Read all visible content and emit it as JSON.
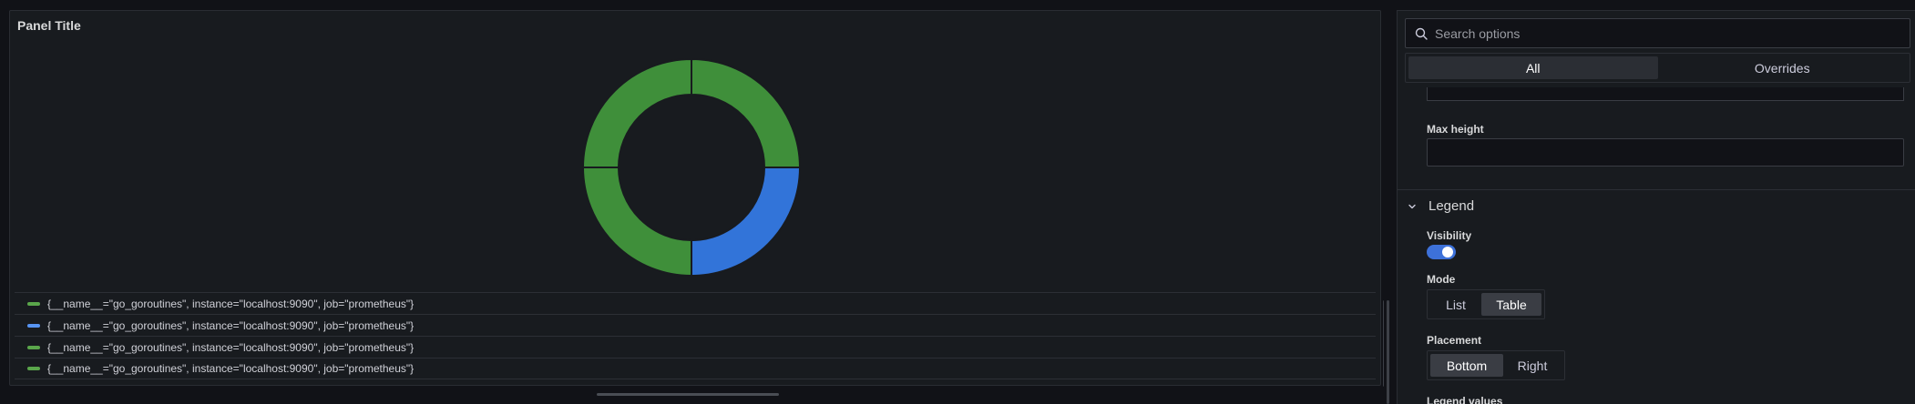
{
  "panel": {
    "title": "Panel Title",
    "legend": [
      {
        "label": "{__name__=\"go_goroutines\", instance=\"localhost:9090\", job=\"prometheus\"}",
        "color": "#5aa64b"
      },
      {
        "label": "{__name__=\"go_goroutines\", instance=\"localhost:9090\", job=\"prometheus\"}",
        "color": "#5794f2"
      },
      {
        "label": "{__name__=\"go_goroutines\", instance=\"localhost:9090\", job=\"prometheus\"}",
        "color": "#5aa64b"
      },
      {
        "label": "{__name__=\"go_goroutines\", instance=\"localhost:9090\", job=\"prometheus\"}",
        "color": "#5aa64b"
      }
    ]
  },
  "chart_data": {
    "type": "pie",
    "donut": true,
    "title": "Panel Title",
    "slices": [
      {
        "name": "{__name__=\"go_goroutines\", instance=\"localhost:9090\", job=\"prometheus\"}",
        "value": 25,
        "color": "#3f8f3a"
      },
      {
        "name": "{__name__=\"go_goroutines\", instance=\"localhost:9090\", job=\"prometheus\"}",
        "value": 25,
        "color": "#3274d9"
      },
      {
        "name": "{__name__=\"go_goroutines\", instance=\"localhost:9090\", job=\"prometheus\"}",
        "value": 25,
        "color": "#3f8f3a"
      },
      {
        "name": "{__name__=\"go_goroutines\", instance=\"localhost:9090\", job=\"prometheus\"}",
        "value": 25,
        "color": "#3f8f3a"
      }
    ],
    "legend_placement": "bottom"
  },
  "options": {
    "search_placeholder": "Search options",
    "tabs": [
      {
        "label": "All",
        "active": true
      },
      {
        "label": "Overrides",
        "active": false
      }
    ],
    "max_height_label": "Max height",
    "max_height_value": "",
    "legend_section": {
      "title": "Legend",
      "visibility_label": "Visibility",
      "visibility_on": true,
      "mode_label": "Mode",
      "mode_options": [
        "List",
        "Table"
      ],
      "mode_selected": "Table",
      "placement_label": "Placement",
      "placement_options": [
        "Bottom",
        "Right"
      ],
      "placement_selected": "Bottom",
      "values_label": "Legend values"
    }
  },
  "colors": {
    "accent_blue": "#3d71d9",
    "series_green": "#5aa64b",
    "series_blue": "#5794f2"
  }
}
